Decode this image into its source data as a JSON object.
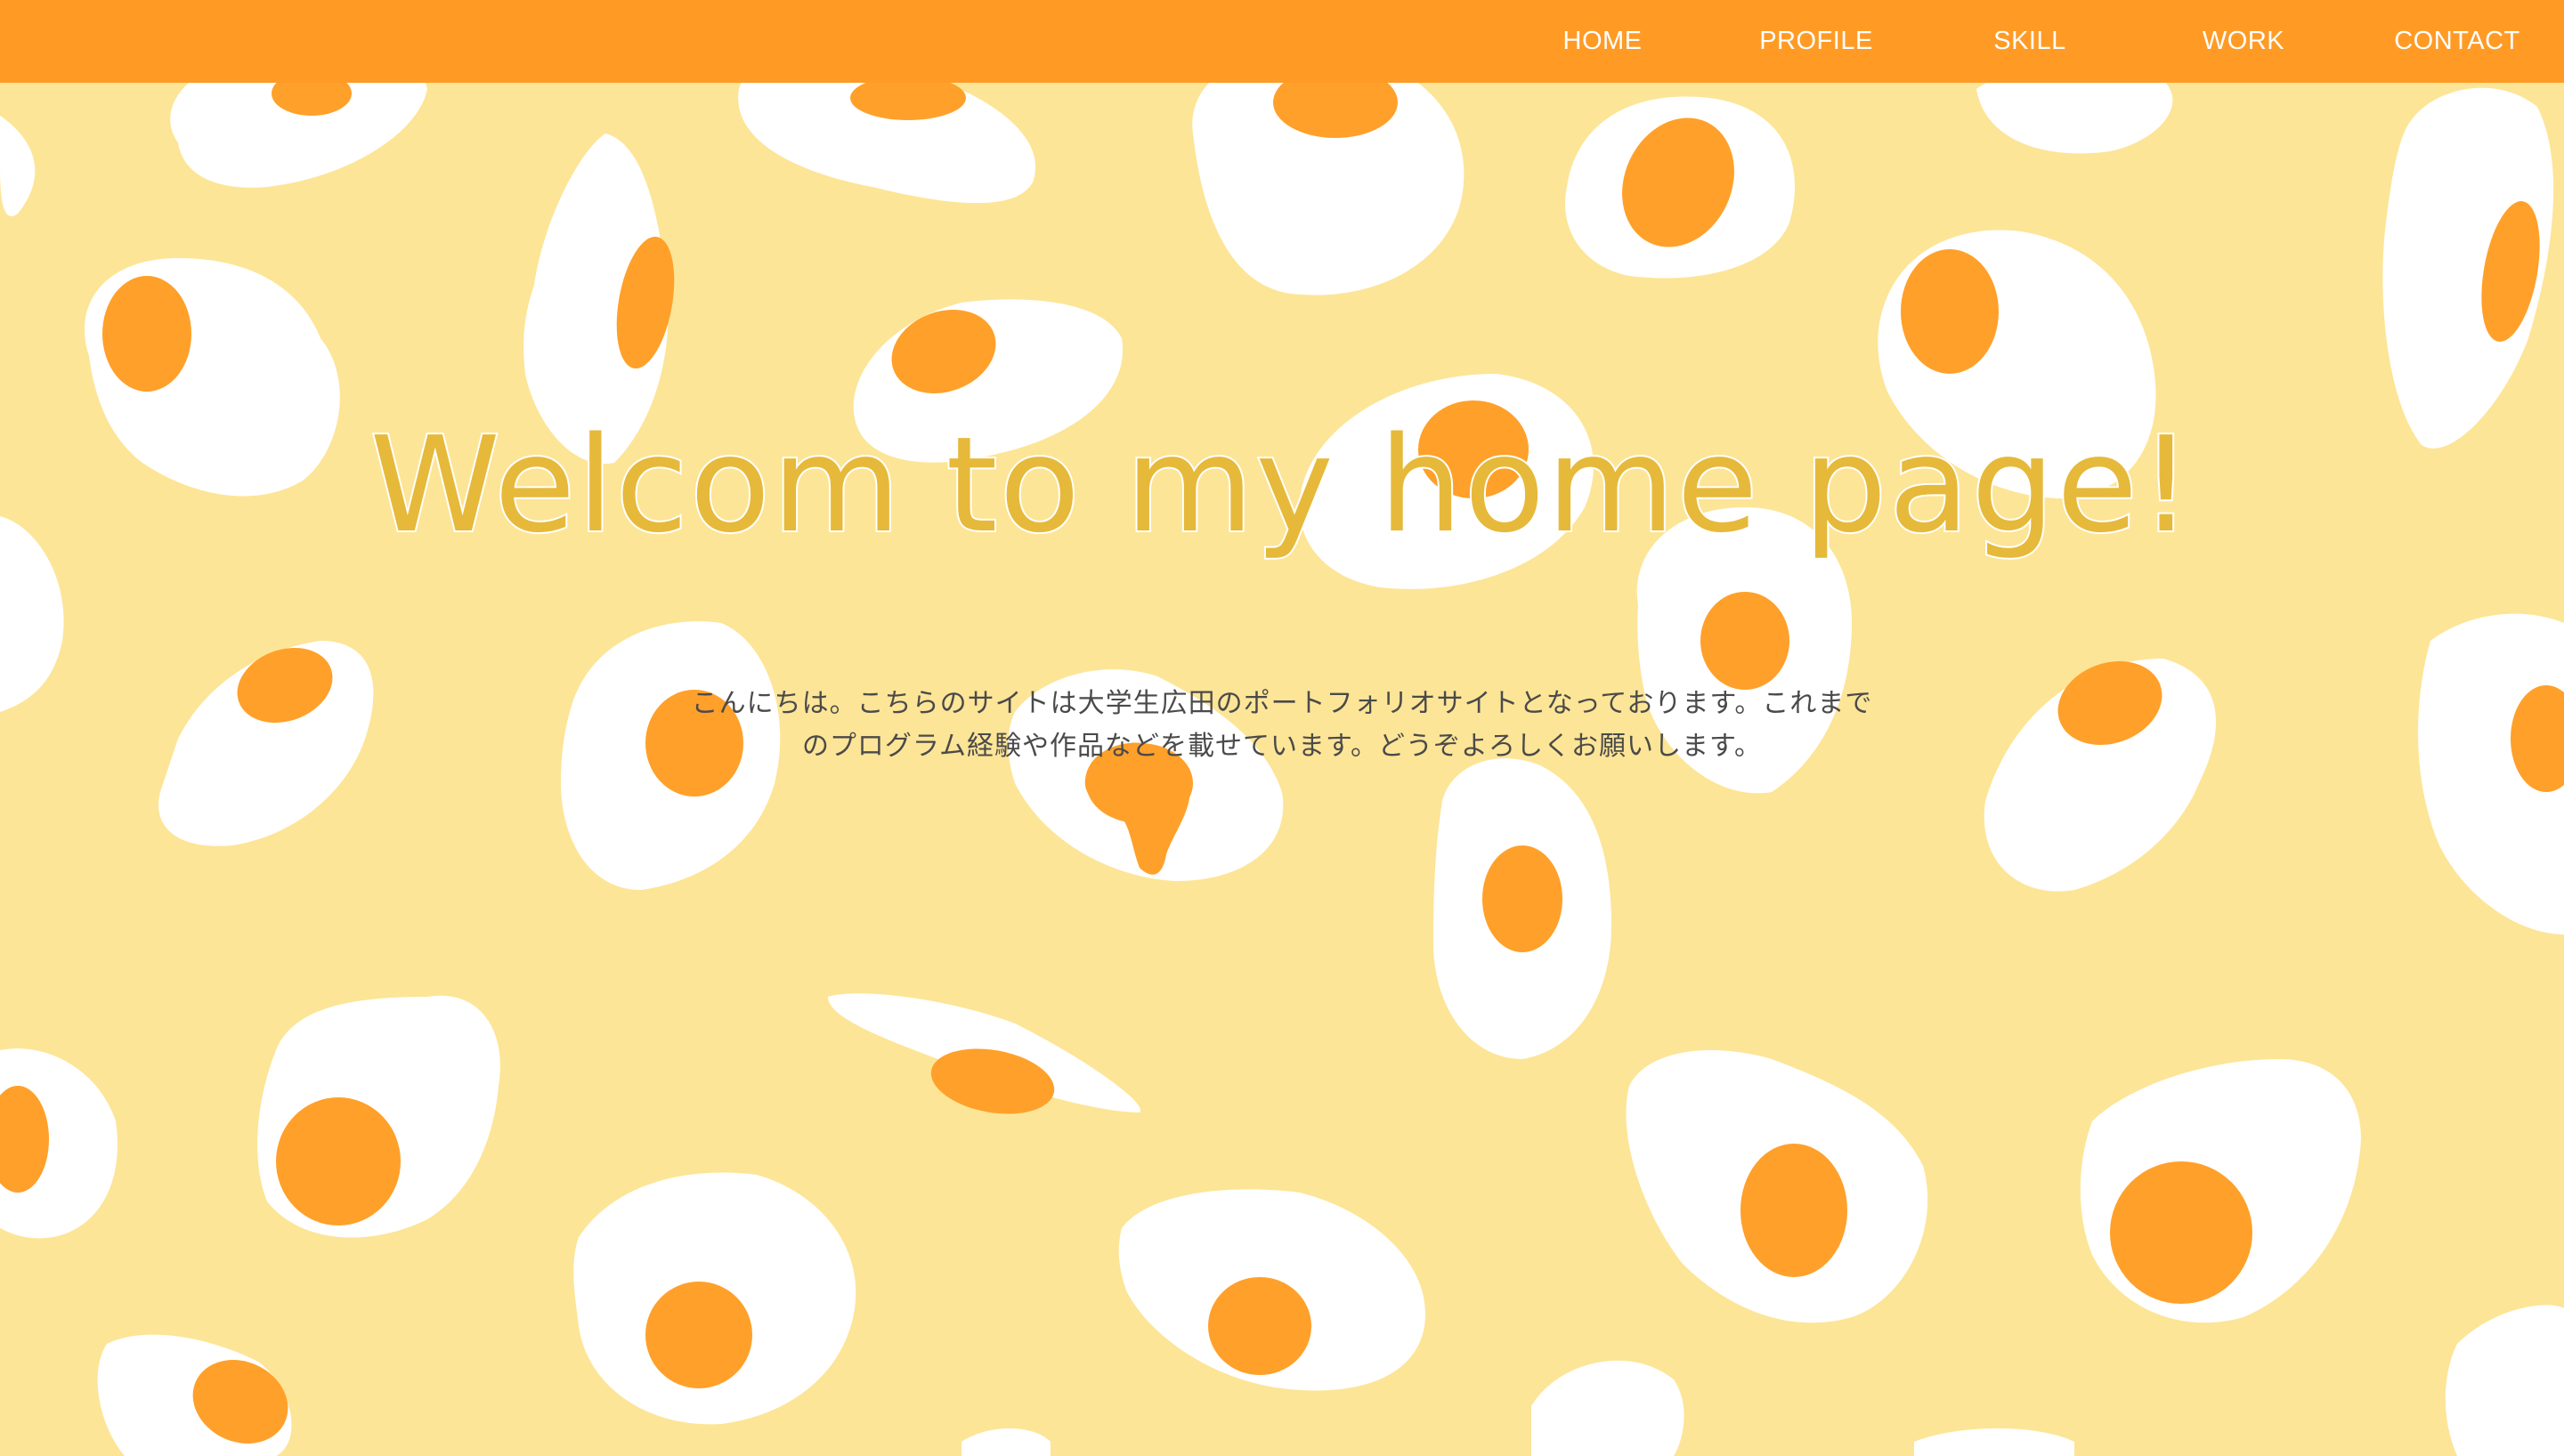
{
  "nav": {
    "items": [
      "HOME",
      "PROFILE",
      "SKILL",
      "WORK",
      "CONTACT"
    ]
  },
  "hero": {
    "title": "Welcom to my home page!",
    "intro_line1": "こんにちは。こちらのサイトは大学生広田のポートフォリオサイトとなっております。これまで",
    "intro_line2": "のプログラム経験や作品などを載せています。どうぞよろしくお願いします。"
  },
  "colors": {
    "navbar": "#ff9b25",
    "background": "#fde597",
    "egg_white": "#ffffff",
    "yolk": "#ffa02a",
    "title": "#e6b93a",
    "text": "#4a4a4a"
  },
  "icons": {
    "background_pattern": "fried-egg-pattern"
  }
}
